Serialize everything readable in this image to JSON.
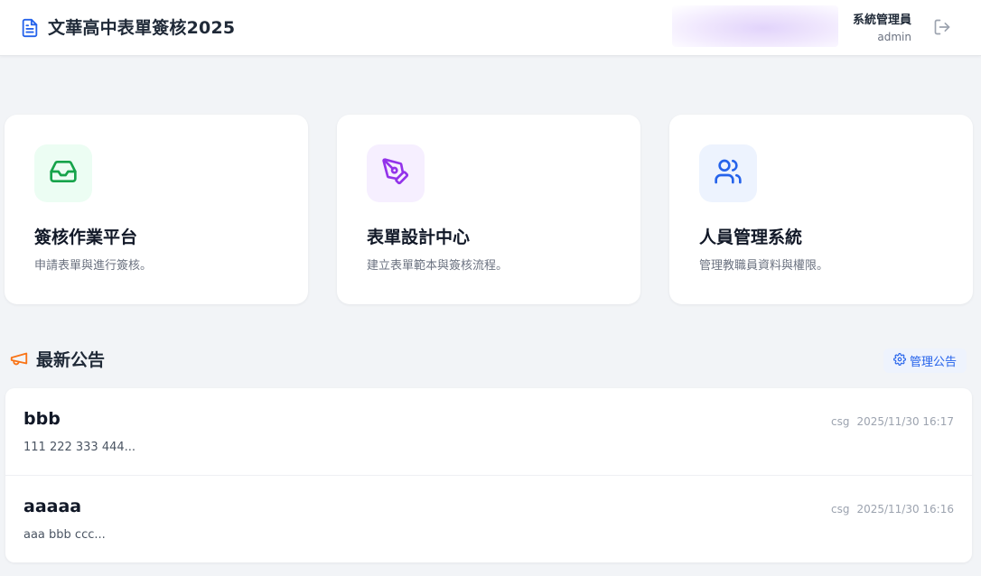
{
  "app": {
    "title": "文華高中表單簽核2025",
    "brand_color": "#2563eb"
  },
  "user": {
    "role": "系統管理員",
    "username": "admin"
  },
  "cards": [
    {
      "title": "簽核作業平台",
      "desc": "申請表單與進行簽核。",
      "icon": "inbox-icon",
      "icon_color": "#16a34a",
      "bg_color": "#ecfdf3"
    },
    {
      "title": "表單設計中心",
      "desc": "建立表單範本與簽核流程。",
      "icon": "pen-tool-icon",
      "icon_color": "#9333ea",
      "bg_color": "#f6efff"
    },
    {
      "title": "人員管理系統",
      "desc": "管理教職員資料與權限。",
      "icon": "users-icon",
      "icon_color": "#2563eb",
      "bg_color": "#edf3fe"
    }
  ],
  "announcements": {
    "title": "最新公告",
    "icon": "megaphone-icon",
    "icon_color": "#f97316",
    "manage_label": "管理公告",
    "items": [
      {
        "title": "bbb",
        "body": "111 222 333 444...",
        "author": "csg",
        "time": "2025/11/30 16:17"
      },
      {
        "title": "aaaaa",
        "body": "aaa bbb ccc...",
        "author": "csg",
        "time": "2025/11/30 16:16"
      }
    ]
  }
}
